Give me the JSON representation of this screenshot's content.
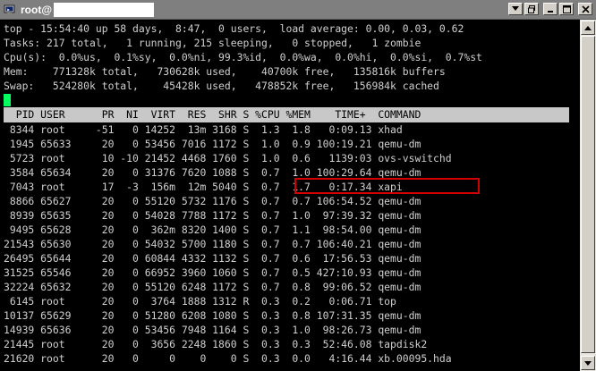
{
  "window": {
    "title": "root@",
    "buttons": {
      "menu": "▾",
      "restore": "▭",
      "minimize": "_",
      "maximize": "□",
      "close": "✕"
    }
  },
  "summary": [
    "top - 15:54:40 up 58 days,  8:47,  0 users,  load average: 0.00, 0.03, 0.62",
    "Tasks: 217 total,   1 running, 215 sleeping,   0 stopped,   1 zombie",
    "Cpu(s):  0.0%us,  0.1%sy,  0.0%ni, 99.3%id,  0.0%wa,  0.0%hi,  0.0%si,  0.7%st",
    "Mem:    771328k total,   730628k used,    40700k free,   135816k buffers",
    "Swap:   524280k total,    45428k used,   478852k free,   156984k cached"
  ],
  "process_header": "  PID USER      PR  NI  VIRT  RES  SHR S %CPU %MEM    TIME+  COMMAND",
  "processes": [
    " 8344 root     -51   0 14252  13m 3168 S  1.3  1.8   0:09.13 xhad",
    " 1945 65633     20   0 53456 7016 1172 S  1.0  0.9 100:19.21 qemu-dm",
    " 5723 root      10 -10 21452 4468 1760 S  1.0  0.6   1139:03 ovs-vswitchd",
    " 3584 65634     20   0 31376 7620 1088 S  0.7  1.0 100:29.64 qemu-dm",
    " 7043 root      17  -3  156m  12m 5040 S  0.7  1.7   0:17.34 xapi",
    " 8866 65627     20   0 55120 5732 1176 S  0.7  0.7 106:54.52 qemu-dm",
    " 8939 65635     20   0 54028 7788 1172 S  0.7  1.0  97:39.32 qemu-dm",
    " 9495 65628     20   0  362m 8320 1400 S  0.7  1.1  98:54.00 qemu-dm",
    "21543 65630     20   0 54032 5700 1180 S  0.7  0.7 106:40.21 qemu-dm",
    "26495 65644     20   0 60844 4332 1132 S  0.7  0.6  17:56.53 qemu-dm",
    "31525 65546     20   0 66952 3960 1060 S  0.7  0.5 427:10.93 qemu-dm",
    "32224 65632     20   0 55120 6248 1172 S  0.7  0.8  99:06.52 qemu-dm",
    " 6145 root      20   0  3764 1888 1312 R  0.3  0.2   0:06.71 top",
    "10137 65629     20   0 51280 6208 1080 S  0.3  0.8 107:31.35 qemu-dm",
    "14939 65636     20   0 53456 7948 1164 S  0.3  1.0  98:26.73 qemu-dm",
    "21445 root      20   0  3656 2248 1860 S  0.3  0.3  52:46.08 tapdisk2",
    "21620 root      20   0     0    0    0 S  0.3  0.0   4:16.44 xb.00095.hda"
  ],
  "highlighted_process": "xapi",
  "colors": {
    "background": "#000000",
    "text": "#d0d0d0",
    "header_bg": "#c8c8c8",
    "cursor": "#00ff5e",
    "highlight": "#d40000"
  }
}
